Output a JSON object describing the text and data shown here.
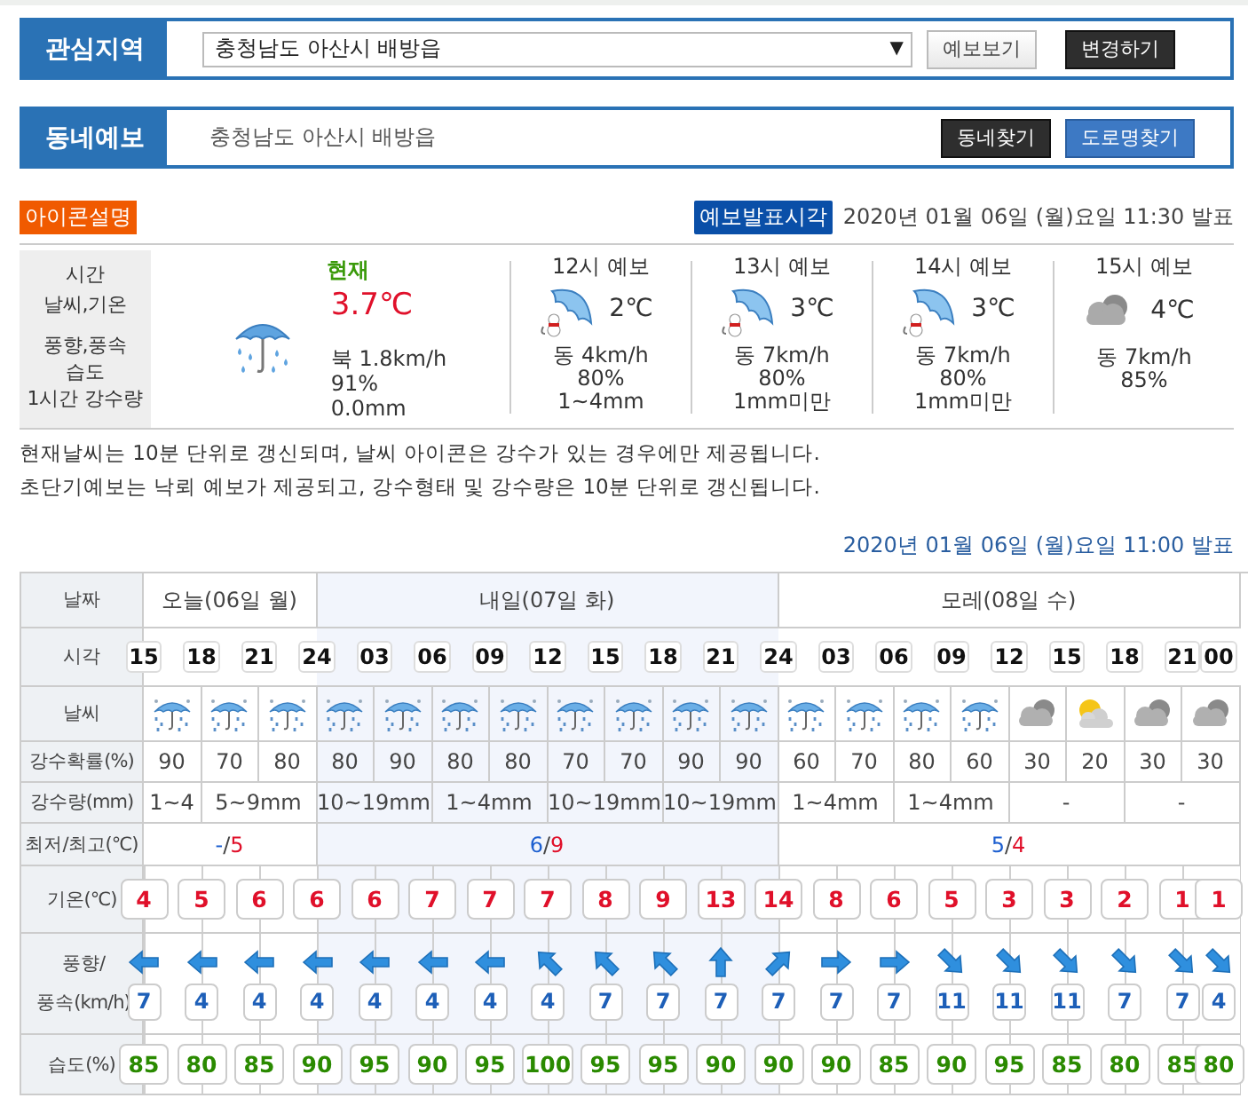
{
  "interest_area": {
    "label": "관심지역",
    "region_select": "충청남도 아산시 배방읍",
    "dropdown_arrow": "▼",
    "buttons": [
      {
        "label": "예보보기",
        "kind": "light"
      },
      {
        "label": "변경하기",
        "kind": "dark"
      }
    ]
  },
  "local_forecast": {
    "label": "동네예보",
    "location": "충청남도 아산시 배방읍",
    "buttons": [
      {
        "label": "동네찾기",
        "kind": "dark"
      },
      {
        "label": "도로명찾기",
        "kind": "blue"
      }
    ]
  },
  "icon_legend_button": "아이콘설명",
  "issue_badge": "예보발표시각",
  "issue_time": "2020년 01월 06일 (월)요일 11:30 발표",
  "current": {
    "row_labels": [
      "시간",
      "날씨,기온",
      "풍향,풍속",
      "습도",
      "1시간 강수량"
    ],
    "title": "현재",
    "kind": "rain",
    "temperature": "3.7℃",
    "wind": "북 1.8km/h",
    "humidity": "91%",
    "precipitation": "0.0mm"
  },
  "ultra_short": [
    {
      "title": "12시 예보",
      "kind": "rain-figure",
      "temperature": "2℃",
      "wind": "동 4km/h",
      "humidity": "80%",
      "precipitation": "1~4mm"
    },
    {
      "title": "13시 예보",
      "kind": "rain-figure",
      "temperature": "3℃",
      "wind": "동 7km/h",
      "humidity": "80%",
      "precipitation": "1mm미만"
    },
    {
      "title": "14시 예보",
      "kind": "rain-figure",
      "temperature": "3℃",
      "wind": "동 7km/h",
      "humidity": "80%",
      "precipitation": "1mm미만"
    },
    {
      "title": "15시 예보",
      "kind": "cloudy",
      "temperature": "4℃",
      "wind": "동 7km/h",
      "humidity": "85%"
    }
  ],
  "notes": [
    "현재날씨는 10분 단위로 갱신되며, 날씨 아이콘은 강수가 있는 경우에만 제공됩니다.",
    "초단기예보는 낙뢰 예보가 제공되고, 강수형태 및 강수량은 10분 단위로 갱신됩니다."
  ],
  "forecast_issue_time": "2020년 01월 06일 (월)요일 11:00 발표",
  "table": {
    "row_labels": {
      "date": "날짜",
      "time": "시각",
      "weather": "날씨",
      "precip_prob": "강수확률(%)",
      "precip_amount": "강수량(mm)",
      "min_max": "최저/최고(℃)",
      "temperature": "기온(℃)",
      "wind": "풍향/\n풍속(km/h)",
      "humidity": "습도(%)"
    },
    "days": [
      {
        "label": "오늘(06일 월)",
        "highlighted": false
      },
      {
        "label": "내일(07일 화)",
        "highlighted": true
      },
      {
        "label": "모레(08일 수)",
        "highlighted": false
      }
    ],
    "times": [
      "15",
      "18",
      "21",
      "24",
      "03",
      "06",
      "09",
      "12",
      "15",
      "18",
      "21",
      "24",
      "03",
      "06",
      "09",
      "12",
      "15",
      "18",
      "21",
      "00"
    ],
    "weather": [
      {
        "kind": "rain"
      },
      {
        "kind": "rain"
      },
      {
        "kind": "rain"
      },
      {
        "kind": "rain"
      },
      {
        "kind": "rain"
      },
      {
        "kind": "rain"
      },
      {
        "kind": "rain"
      },
      {
        "kind": "rain"
      },
      {
        "kind": "rain"
      },
      {
        "kind": "rain"
      },
      {
        "kind": "rain"
      },
      {
        "kind": "rain"
      },
      {
        "kind": "rain"
      },
      {
        "kind": "rain"
      },
      {
        "kind": "rain"
      },
      {
        "kind": "cloudy"
      },
      {
        "kind": "partly-cloudy"
      },
      {
        "kind": "cloudy"
      },
      {
        "kind": "cloudy"
      }
    ],
    "precip_prob": [
      "90",
      "70",
      "80",
      "80",
      "90",
      "80",
      "80",
      "70",
      "70",
      "90",
      "90",
      "60",
      "70",
      "80",
      "60",
      "30",
      "20",
      "30",
      "30"
    ],
    "precip_amount": [
      "1~4",
      "5~9mm",
      "10~19mm",
      "1~4mm",
      "10~19mm",
      "10~19mm",
      "1~4mm",
      "1~4mm",
      "-",
      "-"
    ],
    "min_max": [
      {
        "min": "-",
        "divider": "/",
        "max": "5"
      },
      {
        "min": "6",
        "divider": "/",
        "max": "9"
      },
      {
        "min": "5",
        "divider": "/",
        "max": "4"
      }
    ],
    "temperatures": [
      "4",
      "5",
      "6",
      "6",
      "6",
      "7",
      "7",
      "7",
      "8",
      "9",
      "13",
      "14",
      "8",
      "6",
      "5",
      "3",
      "3",
      "2",
      "1",
      "1"
    ],
    "winds": [
      {
        "kind": "left",
        "speed": "7"
      },
      {
        "kind": "left",
        "speed": "4"
      },
      {
        "kind": "left",
        "speed": "4"
      },
      {
        "kind": "left",
        "speed": "4"
      },
      {
        "kind": "left",
        "speed": "4"
      },
      {
        "kind": "left",
        "speed": "4"
      },
      {
        "kind": "left",
        "speed": "4"
      },
      {
        "kind": "up-left",
        "speed": "4"
      },
      {
        "kind": "up-left",
        "speed": "7"
      },
      {
        "kind": "up-left",
        "speed": "7"
      },
      {
        "kind": "up",
        "speed": "7"
      },
      {
        "kind": "up-right",
        "speed": "7"
      },
      {
        "kind": "right",
        "speed": "7"
      },
      {
        "kind": "right",
        "speed": "7"
      },
      {
        "kind": "down-right",
        "speed": "11"
      },
      {
        "kind": "down-right",
        "speed": "11"
      },
      {
        "kind": "down-right",
        "speed": "11"
      },
      {
        "kind": "down-right",
        "speed": "7"
      },
      {
        "kind": "down-right",
        "speed": "7"
      },
      {
        "kind": "down-right",
        "speed": "4"
      }
    ],
    "humidity": [
      "85",
      "80",
      "85",
      "90",
      "95",
      "90",
      "95",
      "100",
      "95",
      "95",
      "90",
      "90",
      "90",
      "85",
      "90",
      "95",
      "85",
      "80",
      "85",
      "80"
    ]
  }
}
